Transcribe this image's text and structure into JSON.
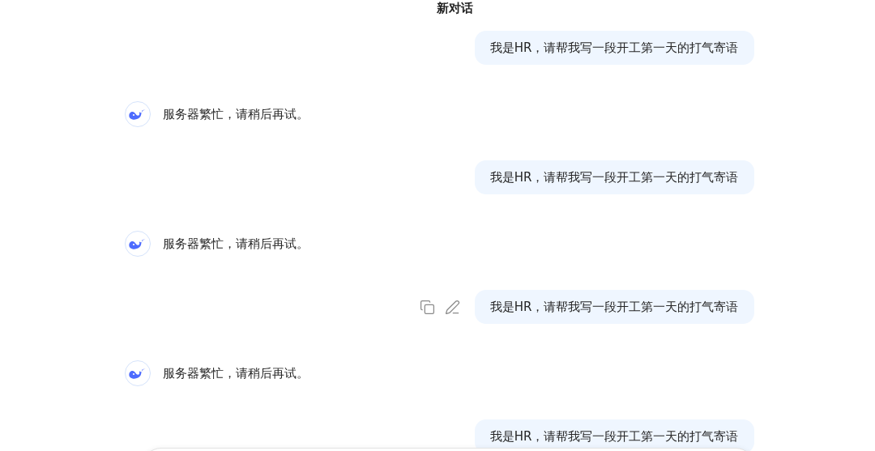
{
  "title": "新对话",
  "messages": [
    {
      "kind": "user",
      "text": "我是HR，请帮我写一段开工第一天的打气寄语",
      "actions_visible": false
    },
    {
      "kind": "assistant",
      "text": "服务器繁忙，请稍后再试。"
    },
    {
      "kind": "user",
      "text": "我是HR，请帮我写一段开工第一天的打气寄语",
      "actions_visible": false
    },
    {
      "kind": "assistant",
      "text": "服务器繁忙，请稍后再试。"
    },
    {
      "kind": "user",
      "text": "我是HR，请帮我写一段开工第一天的打气寄语",
      "actions_visible": true
    },
    {
      "kind": "assistant",
      "text": "服务器繁忙，请稍后再试。"
    },
    {
      "kind": "user",
      "text": "我是HR，请帮我写一段开工第一天的打气寄语",
      "actions_visible": false
    }
  ],
  "input": {
    "kind": "field"
  }
}
